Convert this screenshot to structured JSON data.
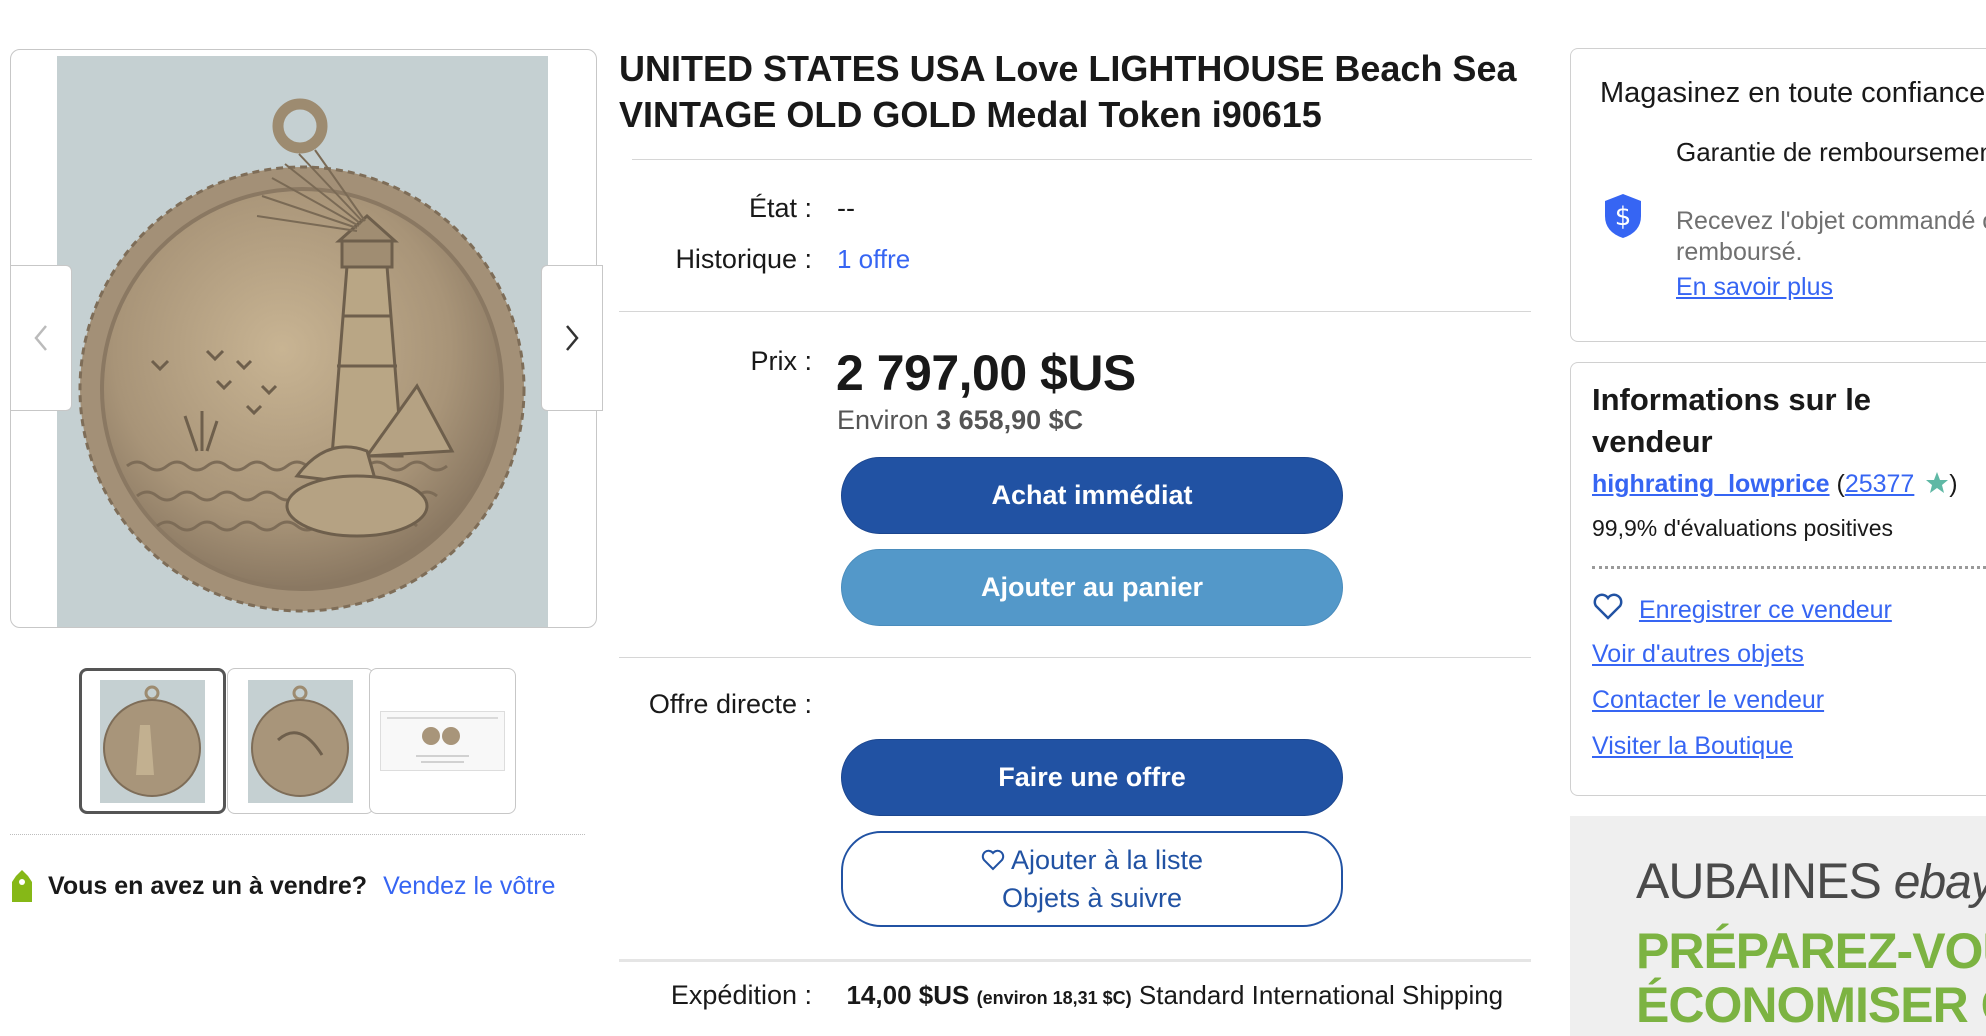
{
  "gallery": {
    "thumbnails": [
      {
        "alt": "Médaille vue avant"
      },
      {
        "alt": "Médaille vue arrière"
      },
      {
        "alt": "Fiche produit"
      }
    ],
    "sell_prompt": "Vous en avez un à vendre?",
    "sell_link": "Vendez le vôtre"
  },
  "listing": {
    "title": "UNITED STATES USA Love LIGHTHOUSE Beach Sea VINTAGE OLD GOLD Medal Token i90615",
    "condition_label": "État :",
    "condition_value": "--",
    "history_label": "Historique :",
    "history_value": "1 offre",
    "price_label": "Prix :",
    "price": "2 797,00 $US",
    "approx_prefix": "Environ",
    "approx_value": "3 658,90 $C",
    "buy_now": "Achat immédiat",
    "add_to_cart": "Ajouter au panier",
    "offer_label": "Offre directe :",
    "make_offer": "Faire une offre",
    "watch_line1": "Ajouter à la liste",
    "watch_line2": "Objets à suivre",
    "shipping_label": "Expédition :",
    "shipping_price": "14,00 $US",
    "shipping_approx": "(environ 18,31 $C)",
    "shipping_method": "Standard International Shipping"
  },
  "trust": {
    "heading": "Magasinez en toute confiance",
    "guarantee_title": "Garantie de remboursement eBay",
    "guarantee_text": "Recevez l'objet commandé ou soyez remboursé.",
    "learn_more": "En savoir plus"
  },
  "seller": {
    "heading": "Informations sur le vendeur",
    "username": "highrating_lowprice",
    "feedback_score": "25377",
    "positive": "99,9% d'évaluations positives",
    "save_seller": "Enregistrer ce vendeur",
    "see_other": "Voir d'autres objets",
    "contact": "Contacter le vendeur",
    "visit_store": "Visiter la Boutique"
  },
  "ad": {
    "brand_line": "AUBAINES",
    "brand_logo": "ebay",
    "headline_1": "PRÉPAREZ-VOUS À",
    "headline_2": "ÉCONOMISER GROS"
  },
  "colors": {
    "primary_button": "#2152a3",
    "secondary_button": "#5398c9",
    "link": "#3665f3",
    "shield": "#3665f3",
    "ad_green": "#7cb342"
  }
}
